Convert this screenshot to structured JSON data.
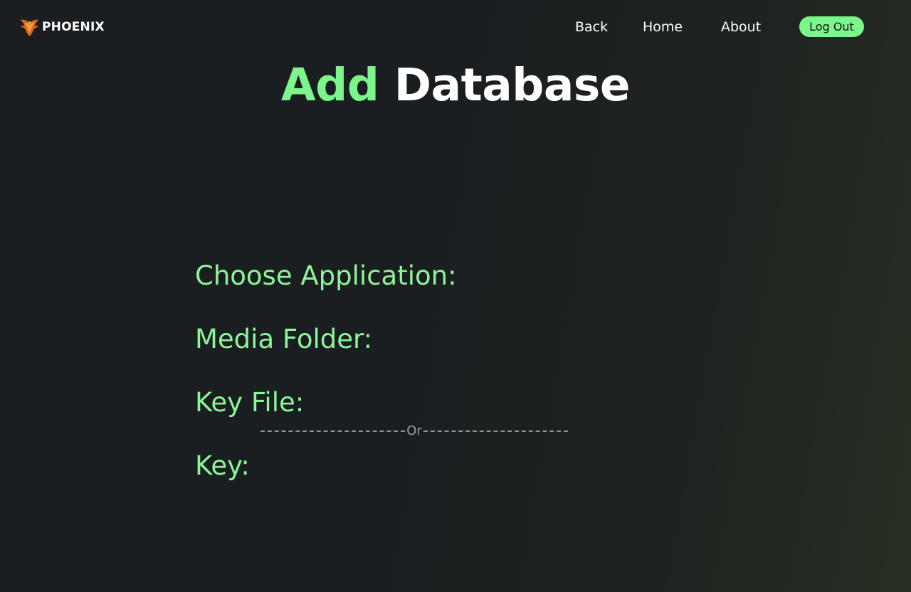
{
  "header": {
    "brand_name": "PHOENIX",
    "brand_icon": "phoenix-logo-icon",
    "nav": {
      "back": "Back",
      "home": "Home",
      "about": "About",
      "logout": "Log Out"
    }
  },
  "title": {
    "accent": "Add",
    "main": "Database"
  },
  "form": {
    "application_label": "Choose Application:",
    "media_folder_label": "Media Folder:",
    "key_file_label": "Key File:",
    "divider_text": "Or",
    "key_label": "Key:"
  },
  "colors": {
    "accent": "#7cf58c",
    "background": "#1b1e21",
    "text": "#ffffff",
    "divider": "#9a9d9b"
  }
}
